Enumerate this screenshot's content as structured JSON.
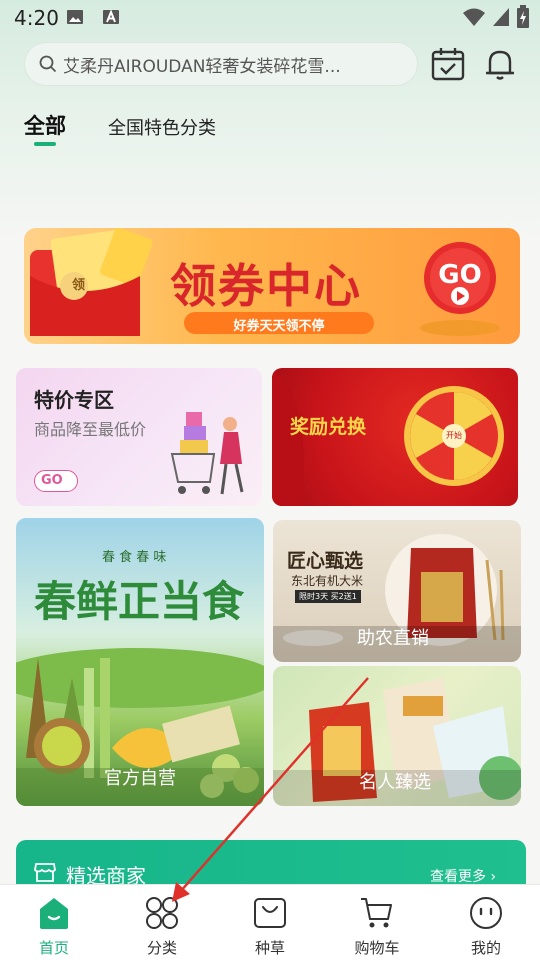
{
  "status": {
    "time": "4:20"
  },
  "search": {
    "placeholder": "艾柔丹AIROUDAN轻奢女装碎花雪..."
  },
  "tabs": [
    {
      "label": "全部"
    },
    {
      "label": "全国特色分类"
    }
  ],
  "banner": {
    "title": "领券中心",
    "subtitle": "好券天天领不停",
    "go": "GO",
    "envelope_top": "领",
    "envelope_side": "领"
  },
  "cards": {
    "special": {
      "title": "特价专区",
      "desc": "商品降至最低价",
      "go": "GO"
    },
    "reward": {
      "title": "奖励兑换",
      "wheel_center": "开始"
    },
    "spring": {
      "kicker": "春 食 春 味",
      "headline": "春鲜正当食",
      "label": "官方自营"
    },
    "farm": {
      "line1": "匠心甄选",
      "line2": "东北有机大米",
      "tag": "限时3天 买2送1",
      "label": "助农直销"
    },
    "celebrity": {
      "label": "名人臻选"
    }
  },
  "merchants": {
    "title": "精选商家",
    "more": "查看更多 ›"
  },
  "tabbar": [
    {
      "label": "首页",
      "icon": "home-icon"
    },
    {
      "label": "分类",
      "icon": "category-icon"
    },
    {
      "label": "种草",
      "icon": "bag-icon"
    },
    {
      "label": "购物车",
      "icon": "cart-icon"
    },
    {
      "label": "我的",
      "icon": "profile-icon"
    }
  ],
  "colors": {
    "accent": "#1bb07a",
    "red": "#d8262a",
    "orange": "#ff8f2e"
  }
}
